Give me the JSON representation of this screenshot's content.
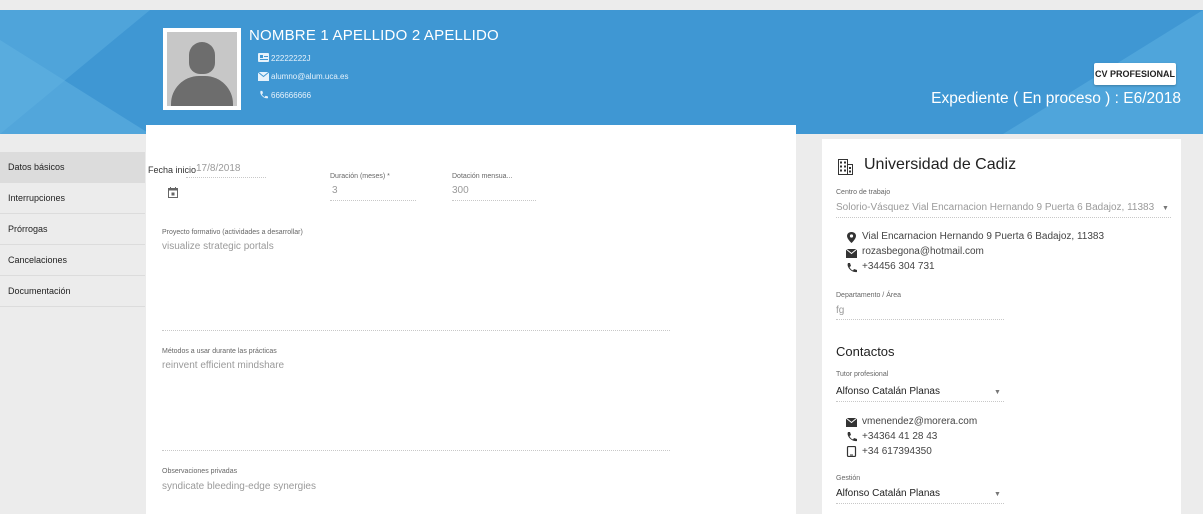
{
  "header": {
    "name": "NOMBRE 1 APELLIDO 2 APELLIDO",
    "id": "22222222J",
    "email": "alumno@alum.uca.es",
    "phone": "666666666",
    "cv_button": "CV PROFESIONAL",
    "expediente": "Expediente ( En proceso ) : E6/2018"
  },
  "sidebar": {
    "items": [
      {
        "label": "Datos básicos"
      },
      {
        "label": "Interrupciones"
      },
      {
        "label": "Prórrogas"
      },
      {
        "label": "Cancelaciones"
      },
      {
        "label": "Documentación"
      }
    ]
  },
  "form": {
    "fecha_label": "Fecha inicio",
    "fecha_value": "17/8/2018",
    "duracion_label": "Duración (meses) *",
    "duracion_value": "3",
    "dotacion_label": "Dotación mensua...",
    "dotacion_value": "300",
    "proyecto_label": "Proyecto formativo (actividades a desarrollar)",
    "proyecto_value": "visualize strategic portals",
    "metodos_label": "Métodos a usar durante las prácticas",
    "metodos_value": "reinvent efficient mindshare",
    "observaciones_label": "Observaciones privadas",
    "observaciones_value": "syndicate bleeding-edge synergies"
  },
  "company": {
    "name": "Universidad de Cadiz",
    "centro_label": "Centro de trabajo",
    "centro_value": "Solorio-Vásquez Vial Encarnacion Hernando 9 Puerta 6 Badajoz, 11383",
    "address": "Vial Encarnacion Hernando 9 Puerta 6 Badajoz, 11383",
    "email": "rozasbegona@hotmail.com",
    "phone": "+34456 304 731",
    "departamento_label": "Departamento / Área",
    "departamento_value": "fg",
    "contactos_title": "Contactos",
    "tutor_label": "Tutor profesional",
    "tutor_value": "Alfonso Catalán Planas",
    "tutor_email": "vmenendez@morera.com",
    "tutor_phone": "+34364 41 28 43",
    "tutor_mobile": "+34 617394350",
    "gestion_label": "Gestión",
    "gestion_value": "Alfonso Catalán Planas"
  },
  "colors": {
    "header_bg": "#3f97d3",
    "accent_text": "#ffffff"
  }
}
